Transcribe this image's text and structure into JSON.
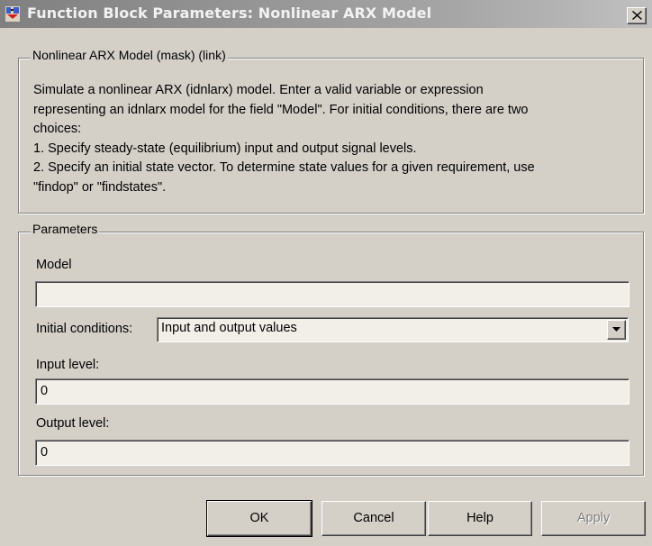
{
  "window": {
    "title": "Function Block Parameters: Nonlinear ARX Model"
  },
  "description": {
    "group_label": "Nonlinear ARX Model (mask) (link)",
    "lines": [
      "Simulate a nonlinear ARX (idnlarx) model. Enter a valid variable or expression",
      "representing an idnlarx model for the field \"Model\". For initial conditions, there are two",
      "choices:",
      "1.  Specify steady-state (equilibrium) input and output signal levels.",
      "2. Specify an initial state vector. To determine state values for a given requirement, use",
      "\"findop\" or \"findstates\"."
    ]
  },
  "parameters": {
    "group_label": "Parameters",
    "model_label": "Model",
    "model_value": "",
    "initial_conditions_label": "Initial conditions:",
    "initial_conditions_value": "Input and output values",
    "input_level_label": "Input level:",
    "input_level_value": "0",
    "output_level_label": "Output level:",
    "output_level_value": "0"
  },
  "buttons": {
    "ok": "OK",
    "cancel": "Cancel",
    "help": "Help",
    "apply": "Apply"
  }
}
